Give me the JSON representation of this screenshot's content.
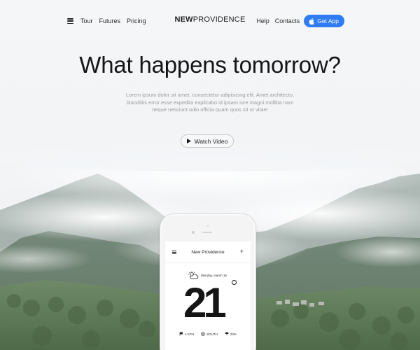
{
  "nav": {
    "links_left": [
      "Tour",
      "Futures",
      "Pricing"
    ],
    "brand_bold": "NEW",
    "brand_light": "PROVIDENCE",
    "links_right": [
      "Help",
      "Contacts"
    ],
    "cta_label": "Get App"
  },
  "hero": {
    "title": "What happens tomorrow?",
    "subtitle": "Lorem ipsum dolor sit amet, consectetur adipisicing elit. Amet architecto, blanditiis error esse expedita explicabo id ipsam iure magni mollitia nam neque nesciunt odio officia quam quos sit ut vitae!",
    "watch_label": "Watch Video"
  },
  "app": {
    "title": "New Providence",
    "date": "Monday, march 16",
    "temperature": "21",
    "stats": [
      {
        "icon": "flag-icon",
        "label": "4 KPH"
      },
      {
        "icon": "compass-icon",
        "label": "SOUTH"
      },
      {
        "icon": "umbrella-icon",
        "label": "23%"
      }
    ]
  },
  "colors": {
    "accent": "#2f7cf6",
    "background": "#f3f5f7"
  }
}
